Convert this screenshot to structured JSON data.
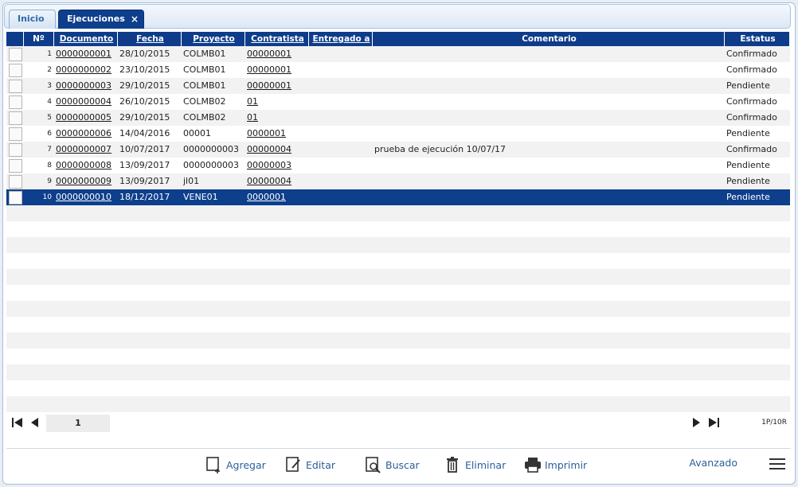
{
  "tabs": [
    {
      "label": "Inicio"
    },
    {
      "label": "Ejecuciones",
      "close": "×"
    }
  ],
  "grid": {
    "columns": [
      "Nº",
      "Documento",
      "Fecha",
      "Proyecto",
      "Contratista",
      "Entregado a",
      "Comentario",
      "Estatus"
    ],
    "rows": [
      {
        "n": "1",
        "documento": "0000000001",
        "fecha": "28/10/2015",
        "proyecto": "COLMB01",
        "contratista": "00000001",
        "entregado": "",
        "comentario": "",
        "estatus": "Confirmado"
      },
      {
        "n": "2",
        "documento": "0000000002",
        "fecha": "23/10/2015",
        "proyecto": "COLMB01",
        "contratista": "00000001",
        "entregado": "",
        "comentario": "",
        "estatus": "Confirmado"
      },
      {
        "n": "3",
        "documento": "0000000003",
        "fecha": "29/10/2015",
        "proyecto": "COLMB01",
        "contratista": "00000001",
        "entregado": "",
        "comentario": "",
        "estatus": "Pendiente"
      },
      {
        "n": "4",
        "documento": "0000000004",
        "fecha": "26/10/2015",
        "proyecto": "COLMB02",
        "contratista": "01",
        "entregado": "",
        "comentario": "",
        "estatus": "Confirmado"
      },
      {
        "n": "5",
        "documento": "0000000005",
        "fecha": "29/10/2015",
        "proyecto": "COLMB02",
        "contratista": "01",
        "entregado": "",
        "comentario": "",
        "estatus": "Confirmado"
      },
      {
        "n": "6",
        "documento": "0000000006",
        "fecha": "14/04/2016",
        "proyecto": "00001",
        "contratista": "0000001",
        "entregado": "",
        "comentario": "",
        "estatus": "Pendiente"
      },
      {
        "n": "7",
        "documento": "0000000007",
        "fecha": "10/07/2017",
        "proyecto": "0000000003",
        "contratista": "00000004",
        "entregado": "",
        "comentario": "prueba de ejecución 10/07/17",
        "estatus": "Confirmado"
      },
      {
        "n": "8",
        "documento": "0000000008",
        "fecha": "13/09/2017",
        "proyecto": "0000000003",
        "contratista": "00000003",
        "entregado": "",
        "comentario": "",
        "estatus": "Pendiente"
      },
      {
        "n": "9",
        "documento": "0000000009",
        "fecha": "13/09/2017",
        "proyecto": "jl01",
        "contratista": "00000004",
        "entregado": "",
        "comentario": "",
        "estatus": "Pendiente"
      },
      {
        "n": "10",
        "documento": "0000000010",
        "fecha": "18/12/2017",
        "proyecto": "VENE01",
        "contratista": "0000001",
        "entregado": "",
        "comentario": "",
        "estatus": "Pendiente",
        "selected": true
      }
    ]
  },
  "pager": {
    "page": "1",
    "info": "1P/10R"
  },
  "toolbar": {
    "agregar": "Agregar",
    "editar": "Editar",
    "buscar": "Buscar",
    "eliminar": "Eliminar",
    "imprimir": "Imprimir",
    "avanzado": "Avanzado"
  },
  "colors": {
    "header": "#0e3c8a",
    "selected_row": "#0d3f8c",
    "accent": "#2d5f9a"
  }
}
